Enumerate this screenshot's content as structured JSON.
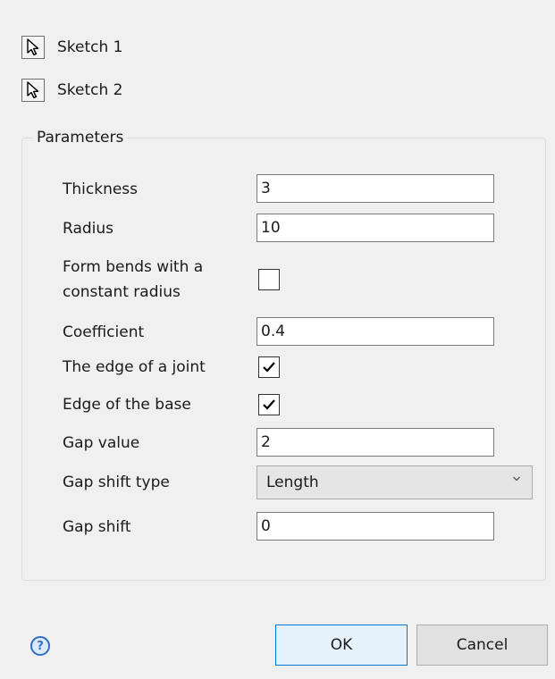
{
  "sketches": [
    {
      "label": "Sketch 1",
      "icon": "cursor-arrow-icon"
    },
    {
      "label": "Sketch 2",
      "icon": "cursor-arrow-icon"
    }
  ],
  "parameters": {
    "group_title": "Parameters",
    "thickness": {
      "label": "Thickness",
      "value": "3"
    },
    "radius": {
      "label": "Radius",
      "value": "10"
    },
    "constant_radius": {
      "label_line1": "Form bends with a",
      "label_line2": "constant radius",
      "checked": false
    },
    "coefficient": {
      "label": "Coefficient",
      "value": "0.4"
    },
    "edge_of_joint": {
      "label": "The edge of a joint",
      "checked": true
    },
    "edge_of_base": {
      "label": "Edge of the base",
      "checked": true
    },
    "gap_value": {
      "label": "Gap value",
      "value": "2"
    },
    "gap_shift_type": {
      "label": "Gap shift type",
      "selected": "Length"
    },
    "gap_shift": {
      "label": "Gap shift",
      "value": "0"
    }
  },
  "footer": {
    "help_icon": "help-question-icon",
    "help_glyph": "?",
    "ok_label": "OK",
    "cancel_label": "Cancel"
  },
  "colors": {
    "background": "#f0f0f0",
    "ok_border": "#0078d7",
    "help_icon": "#2f6fc4"
  }
}
